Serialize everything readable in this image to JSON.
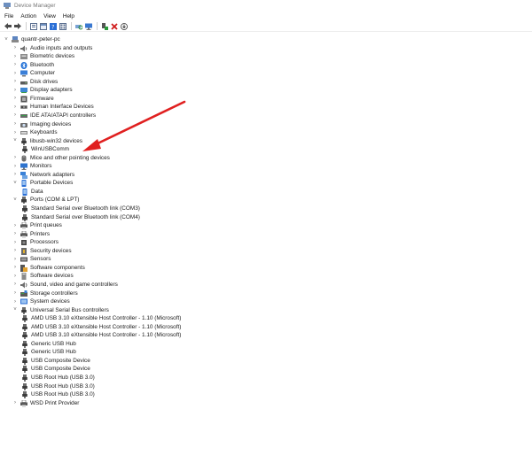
{
  "window": {
    "title": "Device Manager"
  },
  "menu": [
    "File",
    "Action",
    "View",
    "Help"
  ],
  "toolbar_icons": [
    "back-icon",
    "forward-icon",
    "properties-icon",
    "show-hide-icon",
    "help-icon",
    "view-icon",
    "scan-changes-icon",
    "monitor-icon",
    "add-driver-icon",
    "uninstall-icon",
    "update-driver-icon"
  ],
  "tree": [
    {
      "label": "quantr-peter-pc",
      "depth": 0,
      "chev": "v",
      "icon": "computer-root-icon"
    },
    {
      "label": "Audio inputs and outputs",
      "depth": 1,
      "chev": ">",
      "icon": "speaker-icon"
    },
    {
      "label": "Biometric devices",
      "depth": 1,
      "chev": ">",
      "icon": "biometric-icon"
    },
    {
      "label": "Bluetooth",
      "depth": 1,
      "chev": ">",
      "icon": "bluetooth-icon"
    },
    {
      "label": "Computer",
      "depth": 1,
      "chev": ">",
      "icon": "computer-icon"
    },
    {
      "label": "Disk drives",
      "depth": 1,
      "chev": ">",
      "icon": "disk-drive-icon"
    },
    {
      "label": "Display adapters",
      "depth": 1,
      "chev": ">",
      "icon": "display-adapter-icon"
    },
    {
      "label": "Firmware",
      "depth": 1,
      "chev": ">",
      "icon": "firmware-icon"
    },
    {
      "label": "Human Interface Devices",
      "depth": 1,
      "chev": ">",
      "icon": "hid-icon"
    },
    {
      "label": "IDE ATA/ATAPI controllers",
      "depth": 1,
      "chev": ">",
      "icon": "ide-icon"
    },
    {
      "label": "Imaging devices",
      "depth": 1,
      "chev": ">",
      "icon": "camera-icon"
    },
    {
      "label": "Keyboards",
      "depth": 1,
      "chev": ">",
      "icon": "keyboard-icon"
    },
    {
      "label": "libusb-win32 devices",
      "depth": 1,
      "chev": "v",
      "icon": "usb-plug-icon"
    },
    {
      "label": "WinUSBComm",
      "depth": 2,
      "chev": "",
      "icon": "usb-plug-icon"
    },
    {
      "label": "Mice and other pointing devices",
      "depth": 1,
      "chev": ">",
      "icon": "mouse-icon"
    },
    {
      "label": "Monitors",
      "depth": 1,
      "chev": ">",
      "icon": "monitor-icon"
    },
    {
      "label": "Network adapters",
      "depth": 1,
      "chev": ">",
      "icon": "network-icon"
    },
    {
      "label": "Portable Devices",
      "depth": 1,
      "chev": "v",
      "icon": "portable-device-icon"
    },
    {
      "label": "Data",
      "depth": 2,
      "chev": "",
      "icon": "portable-device-icon"
    },
    {
      "label": "Ports (COM & LPT)",
      "depth": 1,
      "chev": "v",
      "icon": "port-icon"
    },
    {
      "label": "Standard Serial over Bluetooth link (COM3)",
      "depth": 2,
      "chev": "",
      "icon": "port-icon"
    },
    {
      "label": "Standard Serial over Bluetooth link (COM4)",
      "depth": 2,
      "chev": "",
      "icon": "port-icon"
    },
    {
      "label": "Print queues",
      "depth": 1,
      "chev": ">",
      "icon": "printer-icon"
    },
    {
      "label": "Printers",
      "depth": 1,
      "chev": ">",
      "icon": "printer-icon"
    },
    {
      "label": "Processors",
      "depth": 1,
      "chev": ">",
      "icon": "processor-icon"
    },
    {
      "label": "Security devices",
      "depth": 1,
      "chev": ">",
      "icon": "security-icon"
    },
    {
      "label": "Sensors",
      "depth": 1,
      "chev": ">",
      "icon": "sensor-icon"
    },
    {
      "label": "Software components",
      "depth": 1,
      "chev": ">",
      "icon": "software-component-icon"
    },
    {
      "label": "Software devices",
      "depth": 1,
      "chev": ">",
      "icon": "software-device-icon"
    },
    {
      "label": "Sound, video and game controllers",
      "depth": 1,
      "chev": ">",
      "icon": "sound-icon"
    },
    {
      "label": "Storage controllers",
      "depth": 1,
      "chev": ">",
      "icon": "storage-icon"
    },
    {
      "label": "System devices",
      "depth": 1,
      "chev": ">",
      "icon": "system-device-icon"
    },
    {
      "label": "Universal Serial Bus controllers",
      "depth": 1,
      "chev": "v",
      "icon": "usb-plug-icon"
    },
    {
      "label": "AMD USB 3.10 eXtensible Host Controller - 1.10 (Microsoft)",
      "depth": 2,
      "chev": "",
      "icon": "usb-plug-icon"
    },
    {
      "label": "AMD USB 3.10 eXtensible Host Controller - 1.10 (Microsoft)",
      "depth": 2,
      "chev": "",
      "icon": "usb-plug-icon"
    },
    {
      "label": "AMD USB 3.10 eXtensible Host Controller - 1.10 (Microsoft)",
      "depth": 2,
      "chev": "",
      "icon": "usb-plug-icon"
    },
    {
      "label": "Generic USB Hub",
      "depth": 2,
      "chev": "",
      "icon": "usb-plug-icon"
    },
    {
      "label": "Generic USB Hub",
      "depth": 2,
      "chev": "",
      "icon": "usb-plug-icon"
    },
    {
      "label": "USB Composite Device",
      "depth": 2,
      "chev": "",
      "icon": "usb-plug-icon"
    },
    {
      "label": "USB Composite Device",
      "depth": 2,
      "chev": "",
      "icon": "usb-plug-icon"
    },
    {
      "label": "USB Root Hub (USB 3.0)",
      "depth": 2,
      "chev": "",
      "icon": "usb-plug-icon"
    },
    {
      "label": "USB Root Hub (USB 3.0)",
      "depth": 2,
      "chev": "",
      "icon": "usb-plug-icon"
    },
    {
      "label": "USB Root Hub (USB 3.0)",
      "depth": 2,
      "chev": "",
      "icon": "usb-plug-icon"
    },
    {
      "label": "WSD Print Provider",
      "depth": 1,
      "chev": ">",
      "icon": "printer-icon"
    }
  ],
  "colors": {
    "annotation_arrow": "#e02020",
    "accent_blue": "#2b6fd6"
  }
}
